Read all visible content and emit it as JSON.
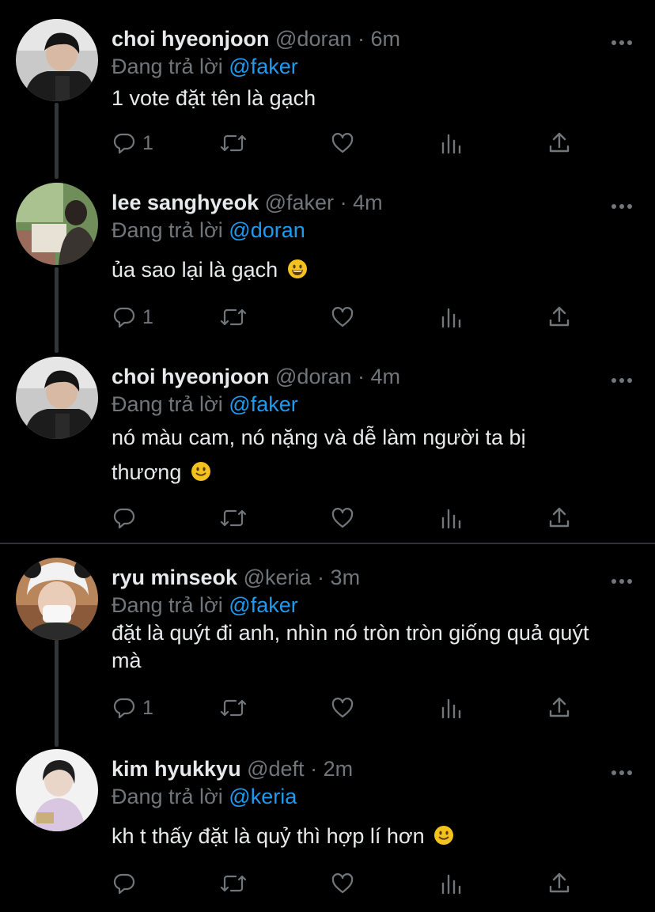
{
  "colors": {
    "background": "#000000",
    "text_primary": "#e7e9ea",
    "text_secondary": "#71767b",
    "mention": "#1d9bf0",
    "divider": "#2f3336"
  },
  "icons": {
    "reply": "reply-icon",
    "retweet": "retweet-icon",
    "like": "heart-icon",
    "analytics": "analytics-icon",
    "share": "share-icon",
    "more": "more-icon"
  },
  "tweets": [
    {
      "name": "choi hyeonjoon",
      "handle": "@doran",
      "separator": "·",
      "time": "6m",
      "replying_prefix": "Đang trả lời",
      "replying_to": "@faker",
      "text": "1 vote đặt tên là gạch",
      "emoji": "",
      "reply_count": "1"
    },
    {
      "name": "lee sanghyeok",
      "handle": "@faker",
      "separator": "·",
      "time": "4m",
      "replying_prefix": "Đang trả lời",
      "replying_to": "@doran",
      "text": "ủa sao lại là gạch",
      "emoji": "grinning-face",
      "reply_count": "1"
    },
    {
      "name": "choi hyeonjoon",
      "handle": "@doran",
      "separator": "·",
      "time": "4m",
      "replying_prefix": "Đang trả lời",
      "replying_to": "@faker",
      "text": "nó màu cam, nó nặng và dễ làm người ta bị thương",
      "emoji": "slightly-smiling-face",
      "reply_count": ""
    },
    {
      "name": "ryu minseok",
      "handle": "@keria",
      "separator": "·",
      "time": "3m",
      "replying_prefix": "Đang trả lời",
      "replying_to": "@faker",
      "text": "đặt là quýt đi anh, nhìn nó tròn tròn giống quả quýt mà",
      "emoji": "",
      "reply_count": "1"
    },
    {
      "name": "kim hyukkyu",
      "handle": "@deft",
      "separator": "·",
      "time": "2m",
      "replying_prefix": "Đang trả lời",
      "replying_to": "@keria",
      "text": "kh t thấy đặt là quỷ thì hợp lí hơn",
      "emoji": "slightly-smiling-face",
      "reply_count": ""
    }
  ]
}
